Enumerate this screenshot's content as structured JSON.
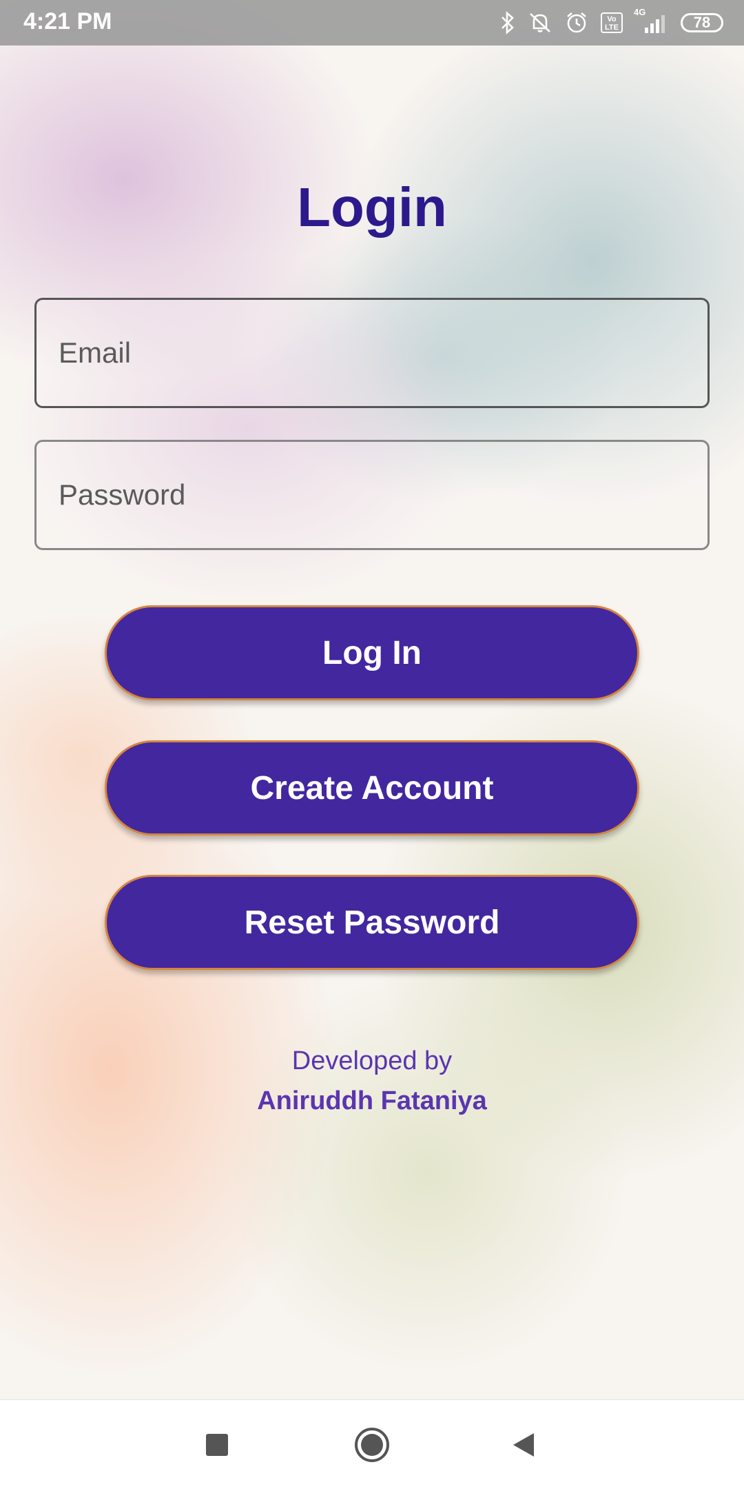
{
  "status_bar": {
    "time": "4:21 PM",
    "network": "4G",
    "lte": "Vo LTE",
    "battery": "78",
    "icons": [
      "bluetooth-icon",
      "mute-notifications-icon",
      "alarm-icon",
      "volte-icon",
      "signal-icon",
      "battery-icon"
    ]
  },
  "login": {
    "title": "Login",
    "email_placeholder": "Email",
    "password_placeholder": "Password",
    "login_button": "Log In",
    "create_account_button": "Create Account",
    "reset_password_button": "Reset Password"
  },
  "footer": {
    "developed_by": "Developed by",
    "developer_name": "Aniruddh Fataniya"
  },
  "nav_bar": {
    "icons": [
      "recent-apps-icon",
      "home-icon",
      "back-icon"
    ]
  },
  "colors": {
    "accent": "#43279f",
    "title": "#2c1a8c",
    "button_border": "#d4853e",
    "credit_text": "#5a35b0"
  }
}
